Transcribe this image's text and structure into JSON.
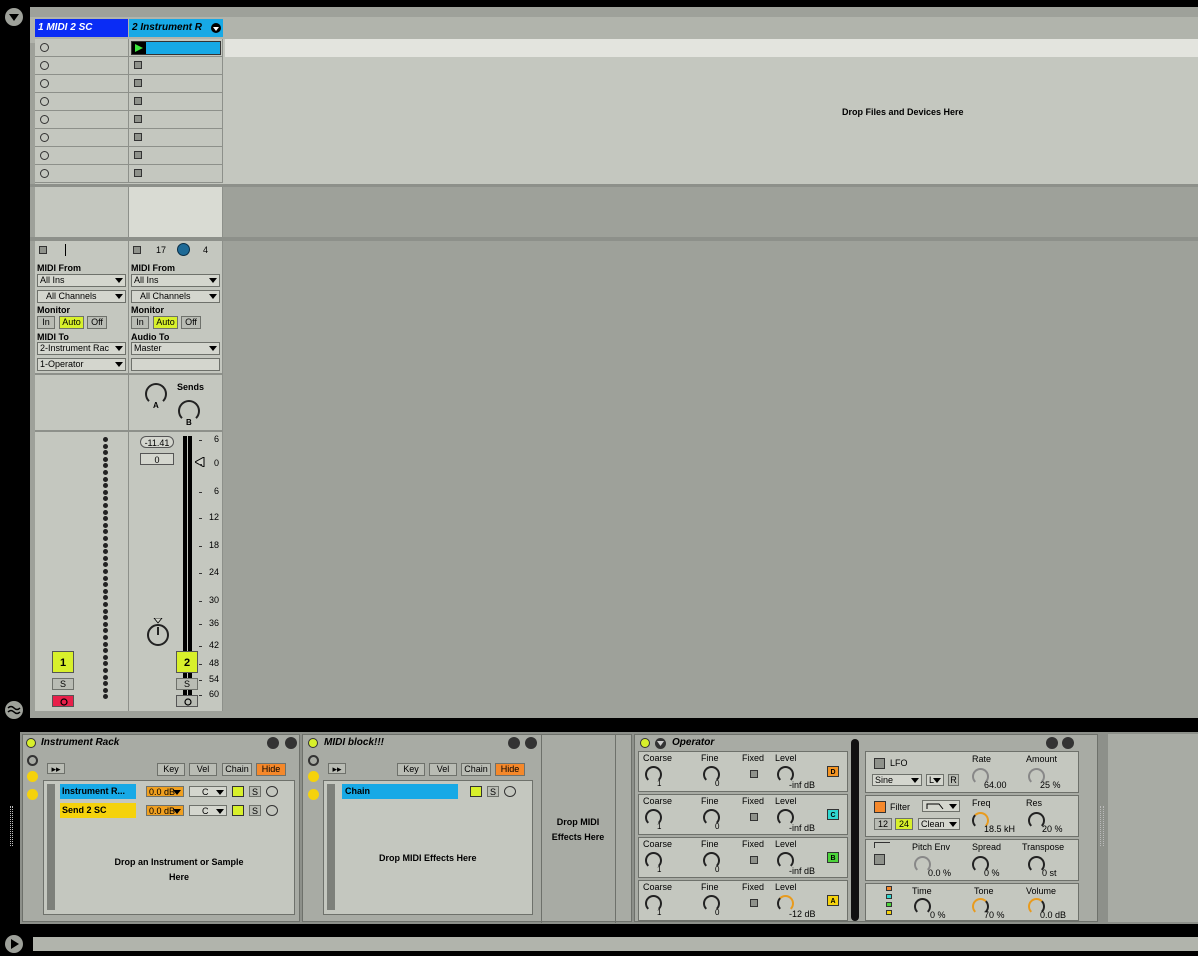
{
  "session": {
    "tracks": [
      {
        "name": "1 MIDI 2 SC",
        "color": "#0a2cf5",
        "number": "1",
        "midi_from_label": "MIDI From",
        "input": "All Ins",
        "channel": "All Channels",
        "monitor_label": "Monitor",
        "monitor": [
          "In",
          "Auto",
          "Off"
        ],
        "out_label": "MIDI To",
        "output": "2-Instrument Rac",
        "output2": "1-Operator",
        "solo": "S"
      },
      {
        "name": "2 Instrument R",
        "color": "#17a9e6",
        "number": "2",
        "midi_from_label": "MIDI From",
        "input": "All Ins",
        "channel": "All Channels",
        "monitor_label": "Monitor",
        "monitor": [
          "In",
          "Auto",
          "Off"
        ],
        "out_label": "Audio To",
        "output": "Master",
        "solo": "S",
        "volume_readout": "-11.41",
        "pan_readout": "0",
        "delay": "17",
        "delay_units": "4"
      }
    ],
    "drop_text": "Drop Files and Devices Here",
    "sends": {
      "title": "Sends",
      "a": "A",
      "b": "B"
    },
    "meter_scale": [
      "6",
      "0",
      "6",
      "12",
      "18",
      "24",
      "30",
      "36",
      "42",
      "48",
      "54",
      "60"
    ]
  },
  "devices": {
    "instrument_rack": {
      "title": "Instrument Rack",
      "buttons": [
        "Key",
        "Vel",
        "Chain",
        "Hide"
      ],
      "chains": [
        {
          "name": "Instrument R...",
          "vol": "0.0 dB",
          "pan": "C",
          "solo": "S",
          "color": "#17a9e6"
        },
        {
          "name": "Send 2 SC",
          "vol": "0.0 dB",
          "pan": "C",
          "solo": "S",
          "color": "#f5d20c"
        }
      ],
      "drop": "Drop an Instrument or Sample Here"
    },
    "midi_block": {
      "title": "MIDI block!!!",
      "buttons": [
        "Key",
        "Vel",
        "Chain",
        "Hide"
      ],
      "chain_name": "Chain",
      "solo": "S",
      "drop": "Drop MIDI Effects Here",
      "drop_side": "Drop MIDI Effects Here"
    },
    "operator": {
      "title": "Operator",
      "oscs": [
        {
          "coarse_label": "Coarse",
          "fine_label": "Fine",
          "fixed_label": "Fixed",
          "level_label": "Level",
          "coarse": "1",
          "fine": "0",
          "level": "-inf dB",
          "tag": "D",
          "tag_color": "#f39423"
        },
        {
          "coarse_label": "Coarse",
          "fine_label": "Fine",
          "fixed_label": "Fixed",
          "level_label": "Level",
          "coarse": "1",
          "fine": "0",
          "level": "-inf dB",
          "tag": "C",
          "tag_color": "#2fd8d0"
        },
        {
          "coarse_label": "Coarse",
          "fine_label": "Fine",
          "fixed_label": "Fixed",
          "level_label": "Level",
          "coarse": "1",
          "fine": "0",
          "level": "-inf dB",
          "tag": "B",
          "tag_color": "#4bd43a"
        },
        {
          "coarse_label": "Coarse",
          "fine_label": "Fine",
          "fixed_label": "Fixed",
          "level_label": "Level",
          "coarse": "1",
          "fine": "0",
          "level": "-12 dB",
          "tag": "A",
          "tag_color": "#f5d20c"
        }
      ],
      "lfo": {
        "label": "LFO",
        "wave": "Sine",
        "mode": "L",
        "retrig": "R",
        "rate_label": "Rate",
        "rate": "64.00",
        "amount_label": "Amount",
        "amount": "25 %"
      },
      "filter": {
        "label": "Filter",
        "slope12": "12",
        "slope24": "24",
        "mode": "Clean",
        "freq_label": "Freq",
        "freq": "18.5 kH",
        "res_label": "Res",
        "res": "20 %"
      },
      "pitch": {
        "label": "Pitch Env",
        "value": "0.0 %",
        "spread_label": "Spread",
        "spread": "0 %",
        "transpose_label": "Transpose",
        "transpose": "0 st"
      },
      "global": {
        "time_label": "Time",
        "time": "0 %",
        "tone_label": "Tone",
        "tone": "70 %",
        "volume_label": "Volume",
        "volume": "0.0 dB"
      }
    }
  }
}
